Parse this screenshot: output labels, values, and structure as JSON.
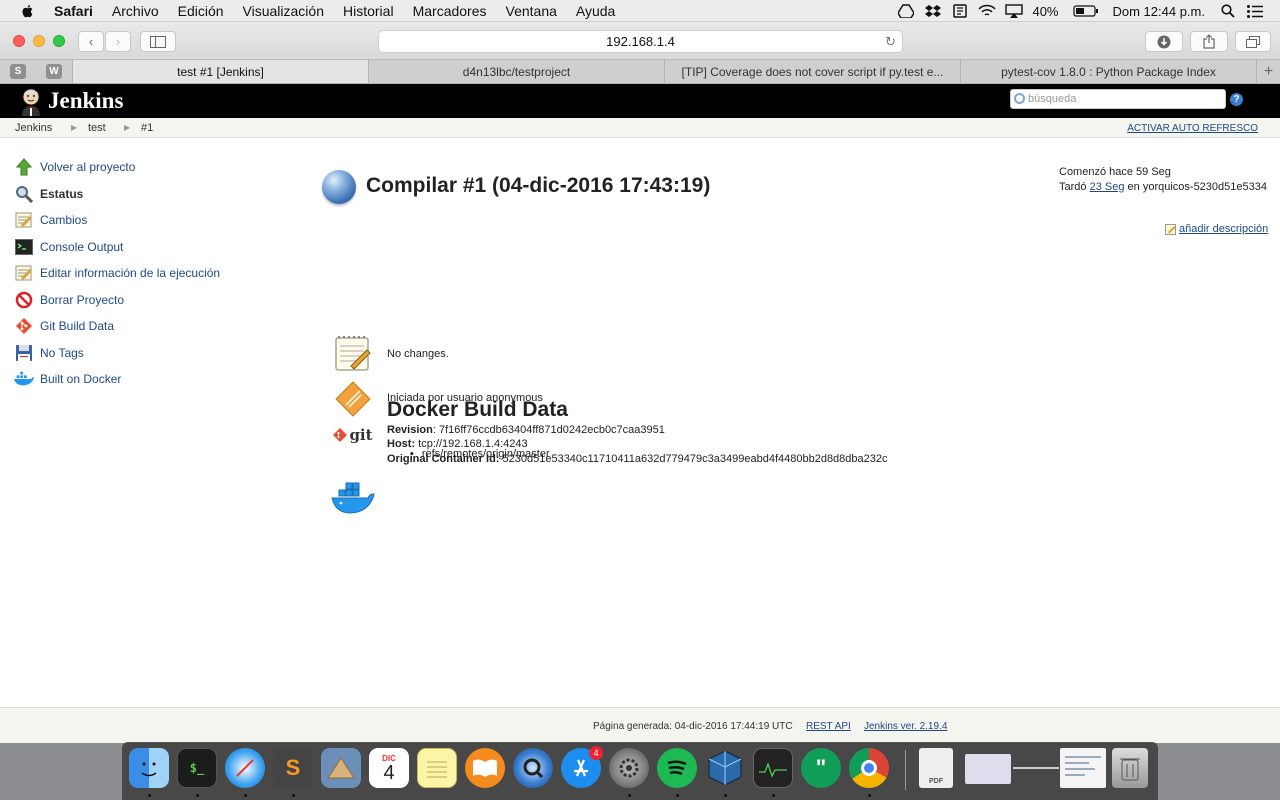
{
  "menubar": {
    "app": "Safari",
    "items": [
      "Archivo",
      "Edición",
      "Visualización",
      "Historial",
      "Marcadores",
      "Ventana",
      "Ayuda"
    ],
    "battery": "40%",
    "clock": "Dom 12:44 p.m."
  },
  "browser": {
    "url": "192.168.1.4",
    "pinned": [
      "S",
      "W"
    ],
    "tabs": [
      "test #1 [Jenkins]",
      "d4n13lbc/testproject",
      "[TIP] Coverage does not cover script if py.test e...",
      "pytest-cov 1.8.0 : Python Package Index"
    ]
  },
  "header": {
    "title": "Jenkins",
    "search_placeholder": "búsqueda",
    "help": "?"
  },
  "breadcrumbs": [
    "Jenkins",
    "test",
    "#1"
  ],
  "autorefresh": "ACTIVAR AUTO REFRESCO",
  "sidebar": [
    {
      "label": "Volver al proyecto",
      "icon": "up-arrow-icon"
    },
    {
      "label": "Estatus",
      "icon": "magnifier-icon"
    },
    {
      "label": "Cambios",
      "icon": "notepad-icon"
    },
    {
      "label": "Console Output",
      "icon": "terminal-icon"
    },
    {
      "label": "Editar información de la ejecución",
      "icon": "notepad-icon"
    },
    {
      "label": "Borrar Proyecto",
      "icon": "no-entry-icon"
    },
    {
      "label": "Git Build Data",
      "icon": "git-icon"
    },
    {
      "label": "No Tags",
      "icon": "floppy-icon"
    },
    {
      "label": "Built on Docker",
      "icon": "docker-icon"
    }
  ],
  "build": {
    "title": "Compilar #1 (04-dic-2016 17:43:19)",
    "started": "Comenzó hace 59 Seg",
    "took_prefix": "Tardó",
    "took_link": "23 Seg",
    "took_suffix": "en yorquicos-5230d51e5334",
    "add_description": "añadir descripción",
    "changes": "No changes.",
    "started_by": "Iniciada por usuario anonymous",
    "revision_label": "Revision",
    "revision": ": 7f16ff76ccdb63404ff871d0242ecb0c7caa3951",
    "ref": "refs/remotes/origin/master",
    "git_logo_text": "git"
  },
  "docker": {
    "title": "Docker Build Data",
    "host_label": "Host:",
    "host": "tcp://192.168.1.4:4243",
    "container_label": "Original Container Id:",
    "container": "5230d51e53340c11710411a632d779479c3a3499eabd4f4480bb2d8d8dba232c"
  },
  "footer": {
    "generated": "Página generada: 04-dic-2016 17:44:19 UTC",
    "rest_api": "REST API",
    "version": "Jenkins ver. 2.19.4"
  },
  "dock": {
    "calendar_month": "DIC",
    "calendar_day": "4",
    "appstore_badge": "4",
    "preview_label": "PDF"
  }
}
